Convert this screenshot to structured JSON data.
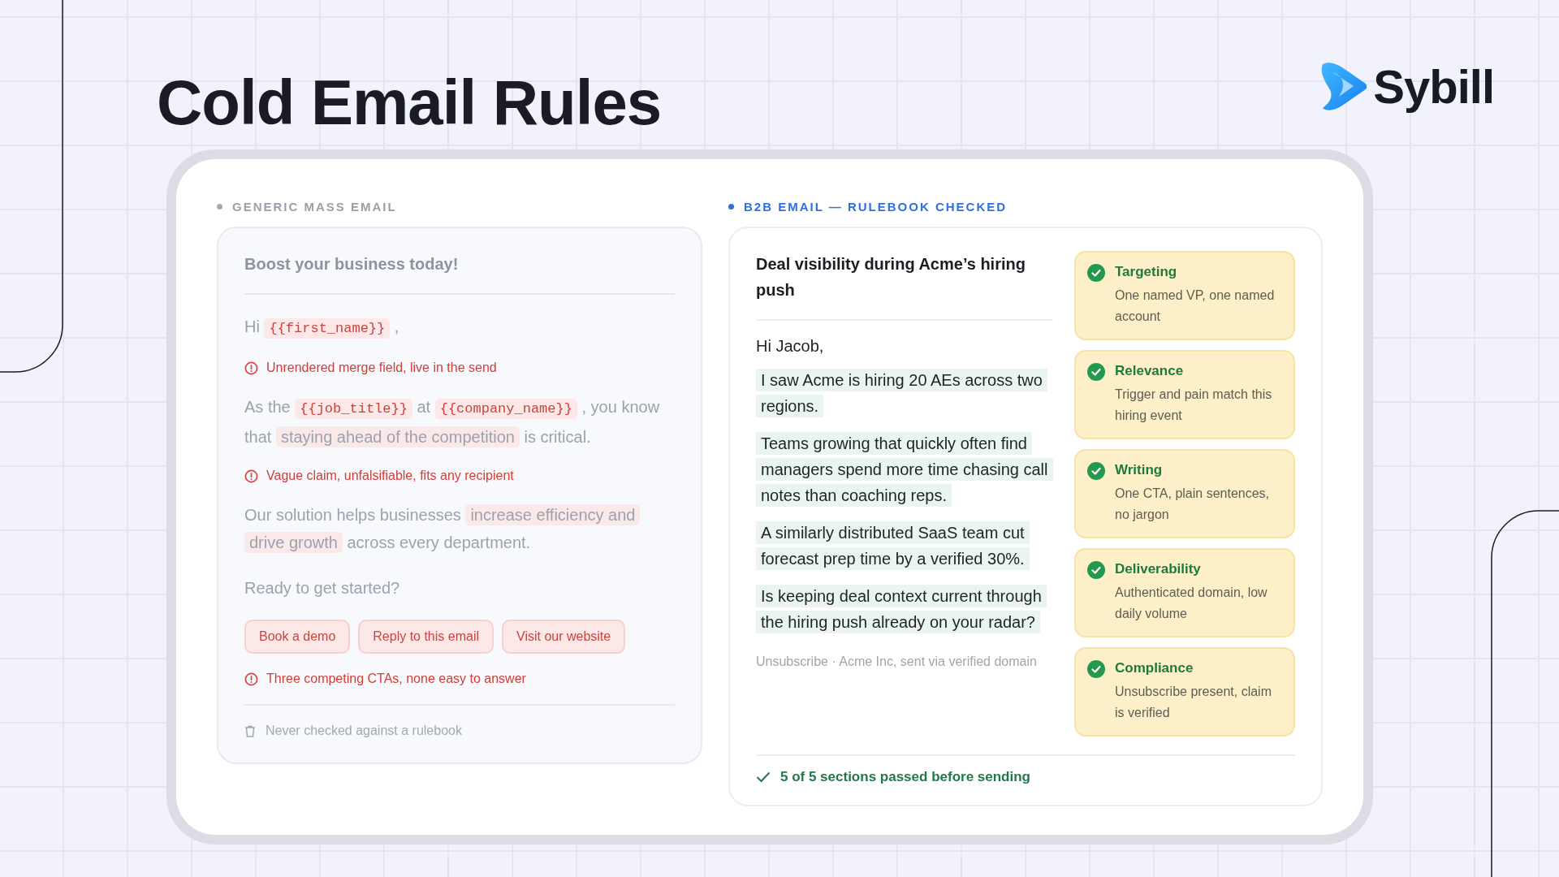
{
  "title": "Cold Email Rules",
  "logo": {
    "text": "Sybill"
  },
  "generic": {
    "label": "GENERIC MASS EMAIL",
    "subject": "Boost your business today!",
    "blocks": [
      {
        "kind": "paragraph",
        "segments": [
          {
            "kind": "text",
            "text": "Hi "
          },
          {
            "kind": "merge",
            "text": "{{first_name}}"
          },
          {
            "kind": "text",
            "text": " ,"
          }
        ]
      },
      {
        "kind": "warning",
        "text": "Unrendered merge field, live in the send"
      },
      {
        "kind": "paragraph",
        "segments": [
          {
            "kind": "text",
            "text": "As the "
          },
          {
            "kind": "merge",
            "text": "{{job_title}}"
          },
          {
            "kind": "text",
            "text": " at "
          },
          {
            "kind": "merge",
            "text": "{{company_name}}"
          },
          {
            "kind": "text",
            "text": " , you know that "
          },
          {
            "kind": "highlight",
            "text": "staying ahead of the competition"
          },
          {
            "kind": "text",
            "text": " is critical."
          }
        ]
      },
      {
        "kind": "warning",
        "text": "Vague claim, unfalsifiable, fits any recipient"
      },
      {
        "kind": "paragraph",
        "segments": [
          {
            "kind": "text",
            "text": "Our solution helps businesses "
          },
          {
            "kind": "highlight",
            "text": "increase efficiency and drive growth"
          },
          {
            "kind": "text",
            "text": " across every department."
          }
        ]
      },
      {
        "kind": "paragraph",
        "segments": [
          {
            "kind": "text",
            "text": "Ready to get started?"
          }
        ]
      },
      {
        "kind": "buttons",
        "items": [
          "Book a demo",
          "Reply to this email",
          "Visit our website"
        ]
      },
      {
        "kind": "warning",
        "text": "Three competing CTAs, none easy to answer"
      }
    ],
    "footer": "Never checked against a rulebook"
  },
  "checked": {
    "label": "B2B EMAIL — RULEBOOK CHECKED",
    "subject": "Deal visibility during Acme’s hiring push",
    "greeting": "Hi Jacob,",
    "paragraphs": [
      "I saw Acme is hiring 20 AEs across two regions.",
      "Teams growing that quickly often find managers spend more time chasing call notes than coaching reps.",
      "A similarly distributed SaaS team cut forecast prep time by a verified 30%.",
      "Is keeping deal context current through the hiring push already on your radar?"
    ],
    "signature": "Unsubscribe · Acme Inc, sent via verified domain",
    "rules": [
      {
        "title": "Targeting",
        "description": "One named VP, one named account",
        "passed": true
      },
      {
        "title": "Relevance",
        "description": "Trigger and pain match this hiring event",
        "passed": true
      },
      {
        "title": "Writing",
        "description": "One CTA, plain sentences, no jargon",
        "passed": true
      },
      {
        "title": "Deliverability",
        "description": "Authenticated domain, low daily volume",
        "passed": true
      },
      {
        "title": "Compliance",
        "description": "Unsubscribe present, claim is verified",
        "passed": true
      }
    ],
    "summary": "5 of 5 sections passed before sending"
  }
}
